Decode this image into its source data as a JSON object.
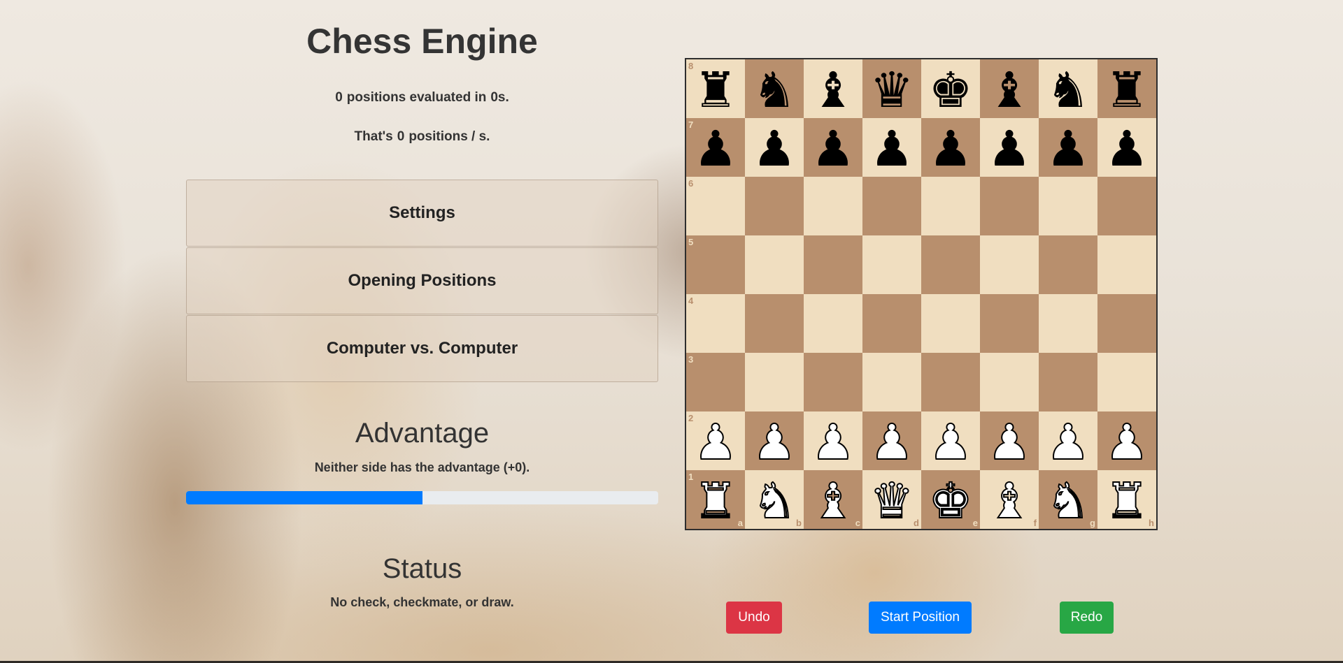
{
  "header": {
    "title": "Chess Engine",
    "positions_count": "0",
    "positions_text": "positions evaluated in",
    "time": "0s.",
    "rate_prefix": "That's",
    "rate": "0",
    "rate_suffix": "positions / s."
  },
  "accordion": {
    "items": [
      {
        "label": "Settings"
      },
      {
        "label": "Opening Positions"
      },
      {
        "label": "Computer vs. Computer"
      }
    ]
  },
  "advantage": {
    "title": "Advantage",
    "text": "Neither side has the advantage (+0).",
    "progress_percent": 50,
    "bar_color": "#007bff"
  },
  "status": {
    "title": "Status",
    "text": "No check, checkmate, or draw."
  },
  "board": {
    "light_color": "#f0dec0",
    "dark_color": "#b88f6d",
    "files": [
      "a",
      "b",
      "c",
      "d",
      "e",
      "f",
      "g",
      "h"
    ],
    "ranks": [
      "8",
      "7",
      "6",
      "5",
      "4",
      "3",
      "2",
      "1"
    ],
    "position": [
      [
        "bR",
        "bN",
        "bB",
        "bQ",
        "bK",
        "bB",
        "bN",
        "bR"
      ],
      [
        "bP",
        "bP",
        "bP",
        "bP",
        "bP",
        "bP",
        "bP",
        "bP"
      ],
      [
        "",
        "",
        "",
        "",
        "",
        "",
        "",
        ""
      ],
      [
        "",
        "",
        "",
        "",
        "",
        "",
        "",
        ""
      ],
      [
        "",
        "",
        "",
        "",
        "",
        "",
        "",
        ""
      ],
      [
        "",
        "",
        "",
        "",
        "",
        "",
        "",
        ""
      ],
      [
        "wP",
        "wP",
        "wP",
        "wP",
        "wP",
        "wP",
        "wP",
        "wP"
      ],
      [
        "wR",
        "wN",
        "wB",
        "wQ",
        "wK",
        "wB",
        "wN",
        "wR"
      ]
    ]
  },
  "controls": {
    "undo_label": "Undo",
    "start_label": "Start Position",
    "redo_label": "Redo"
  }
}
